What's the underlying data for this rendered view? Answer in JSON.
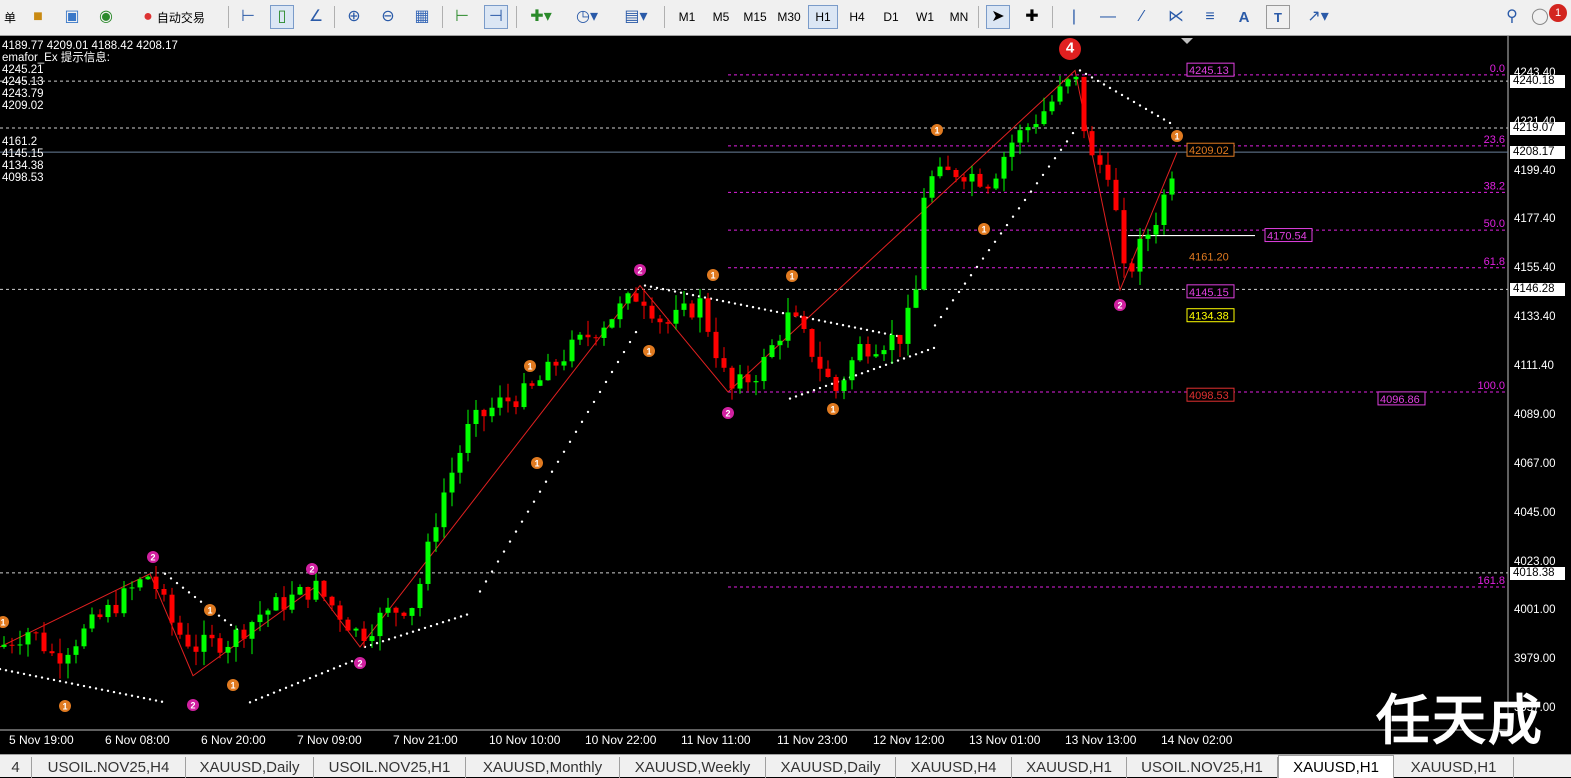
{
  "toolbar": {
    "menu_cut": "单",
    "autotrade": "自动交易",
    "timeframes": [
      "M1",
      "M5",
      "M15",
      "M30",
      "H1",
      "H4",
      "D1",
      "W1",
      "MN"
    ],
    "active_tf": "H1",
    "alert_count": "1"
  },
  "info": {
    "ohlc": "4189.77 4209.01 4188.42 4208.17",
    "indicator": "emafor_Ex 提示信息:",
    "lines": [
      "4245.21",
      "4245.13",
      "4243.79",
      "4209.02",
      "",
      "",
      "4161.2",
      "4145.15",
      "4134.38",
      "4098.53"
    ]
  },
  "y_axis": {
    "ticks": [
      "4243.40",
      "4221.40",
      "4199.40",
      "4177.40",
      "4155.40",
      "4133.40",
      "4111.40",
      "4089.00",
      "4067.00",
      "4045.00",
      "4023.00",
      "4001.00",
      "3979.00",
      "3957.00"
    ],
    "boxes": [
      "4240.18",
      "4219.07",
      "4208.17",
      "4146.28",
      "4018.38"
    ]
  },
  "x_axis": {
    "ticks": [
      "5 Nov 19:00",
      "6 Nov 08:00",
      "6 Nov 20:00",
      "7 Nov 09:00",
      "7 Nov 21:00",
      "10 Nov 10:00",
      "10 Nov 22:00",
      "11 Nov 11:00",
      "11 Nov 23:00",
      "12 Nov 12:00",
      "13 Nov 01:00",
      "13 Nov 13:00",
      "14 Nov 02:00"
    ]
  },
  "fibo": {
    "levels": [
      {
        "label": "0.0",
        "price": 4243.0
      },
      {
        "label": "23.6",
        "price": 4211.0
      },
      {
        "label": "38.2",
        "price": 4190.0
      },
      {
        "label": "50.0",
        "price": 4173.0
      },
      {
        "label": "61.8",
        "price": 4156.0
      },
      {
        "label": "100.0",
        "price": 4100.0
      },
      {
        "label": "161.8",
        "price": 4012.0
      }
    ]
  },
  "price_tags": {
    "t4245": "4245.13",
    "t4209": "4209.02",
    "t4170": "4170.54",
    "t4161": "4161.20",
    "t4145": "4145.15",
    "t4134": "4134.38",
    "t4098": "4098.53",
    "t4096": "4096.86"
  },
  "wave_marker": "4",
  "tabs": [
    "4",
    "USOIL.NOV25,H4",
    "XAUUSD,Daily",
    "USOIL.NOV25,H1",
    "XAUUSD,Monthly",
    "XAUUSD,Weekly",
    "XAUUSD,Daily",
    "XAUUSD,H4",
    "XAUUSD,H1",
    "USOIL.NOV25,H1",
    "XAUUSD,H1",
    "XAUUSD,H1"
  ],
  "active_tab": 10,
  "watermark": "任天成",
  "colors": {
    "up": "#00ff00",
    "down": "#ff0000",
    "fib": "#e020e0",
    "marker1": "#e07a20",
    "marker2": "#d020a0"
  },
  "icons": [
    "menu-icon",
    "auto-trade-icon",
    "crosshair-icon",
    "zoom-in-icon",
    "zoom-out-icon",
    "tile-icon",
    "bar-chart-icon",
    "candle-chart-icon",
    "line-chart-icon",
    "new-order-icon",
    "clock-icon",
    "template-icon",
    "cursor-icon",
    "cross-icon",
    "vline-icon",
    "hline-icon",
    "trendline-icon",
    "channel-icon",
    "fibo-icon",
    "text-icon",
    "label-icon",
    "arrows-icon",
    "search-icon",
    "alert-icon"
  ]
}
